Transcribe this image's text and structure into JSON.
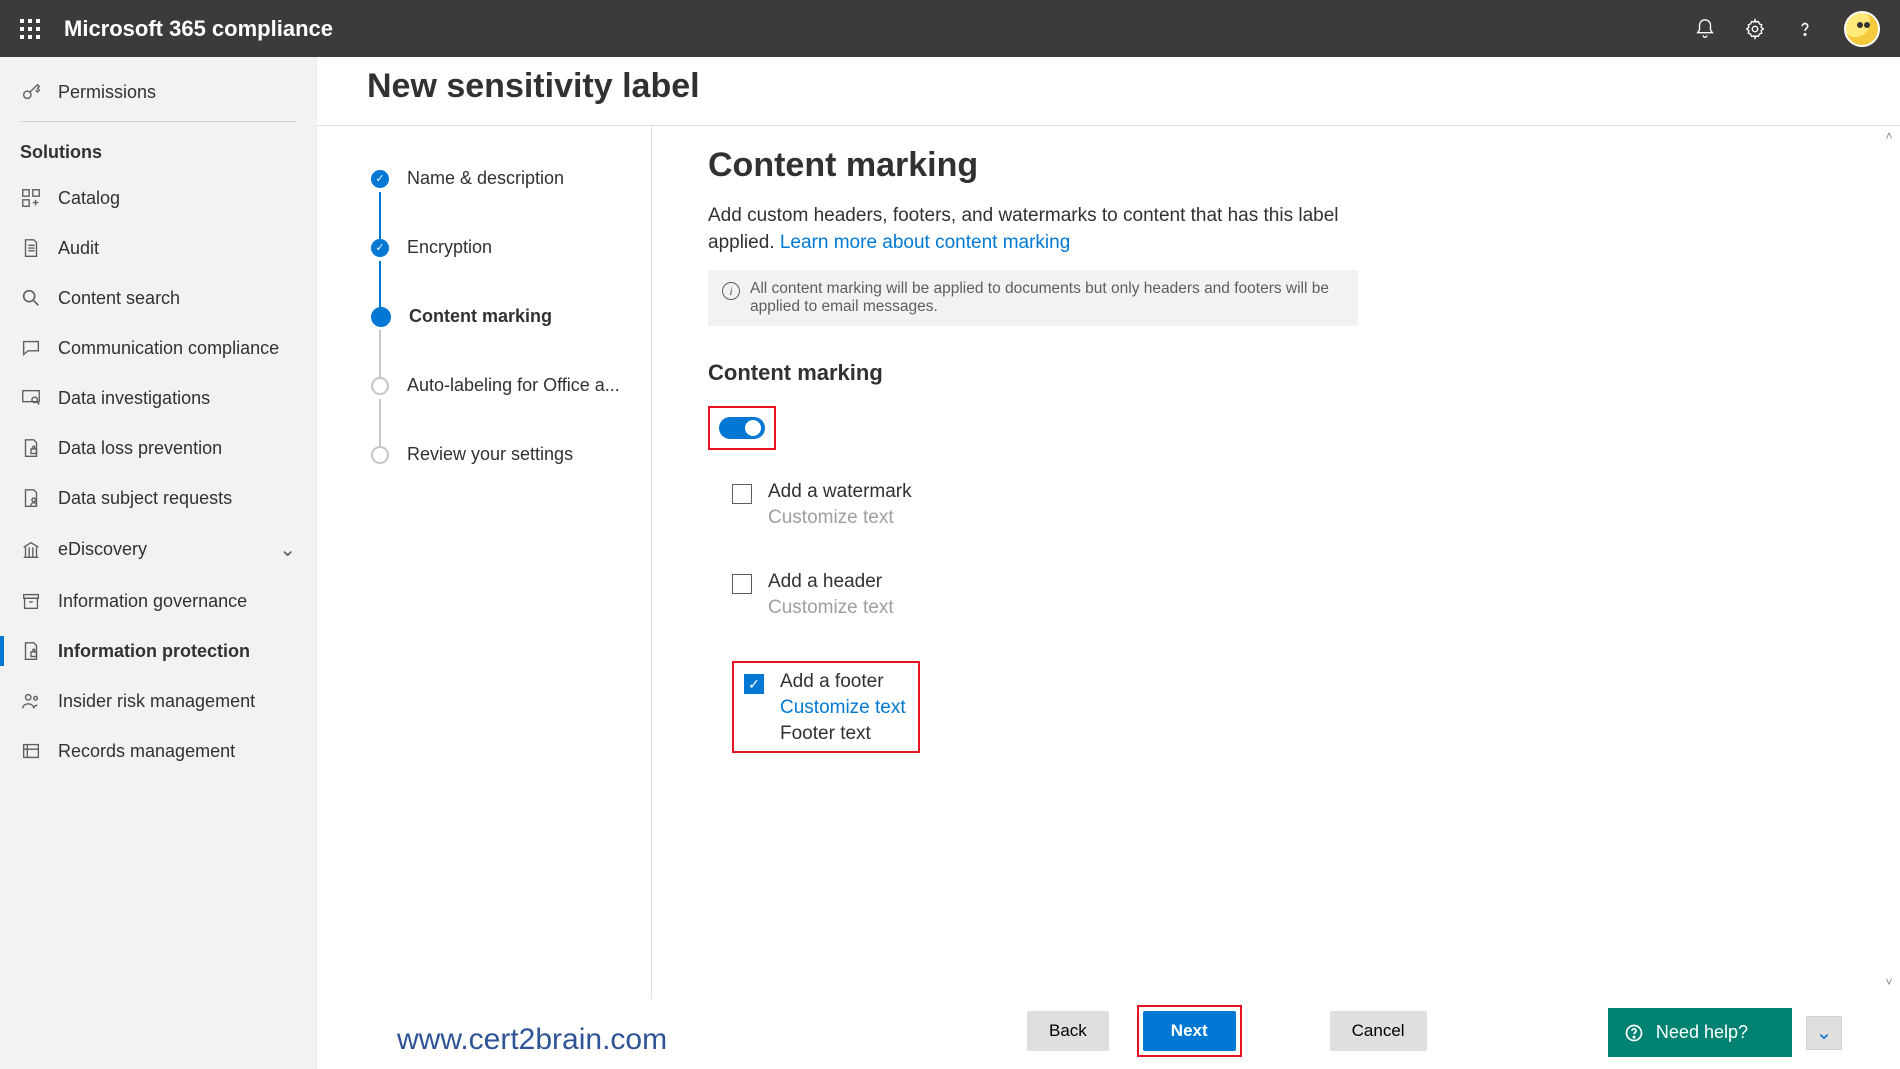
{
  "topbar": {
    "brand": "Microsoft 365 compliance"
  },
  "sidebar": {
    "permissions": "Permissions",
    "solutions_heading": "Solutions",
    "items": [
      {
        "label": "Catalog"
      },
      {
        "label": "Audit"
      },
      {
        "label": "Content search"
      },
      {
        "label": "Communication compliance"
      },
      {
        "label": "Data investigations"
      },
      {
        "label": "Data loss prevention"
      },
      {
        "label": "Data subject requests"
      },
      {
        "label": "eDiscovery"
      },
      {
        "label": "Information governance"
      },
      {
        "label": "Information protection"
      },
      {
        "label": "Insider risk management"
      },
      {
        "label": "Records management"
      }
    ]
  },
  "page_title": "New sensitivity label",
  "steps": {
    "name_desc": "Name & description",
    "encryption": "Encryption",
    "content_marking": "Content marking",
    "auto_labeling": "Auto-labeling for Office a...",
    "review": "Review your settings"
  },
  "pane": {
    "title": "Content marking",
    "desc_1": "Add custom headers, footers, and watermarks to content that has this label applied. ",
    "learn_link": "Learn more about content marking",
    "info": "All content marking will be applied to documents but only headers and footers will be applied to email messages.",
    "section_subtitle": "Content marking",
    "toggle_on": true,
    "options": {
      "watermark": {
        "label": "Add a watermark",
        "customize": "Customize text",
        "checked": false
      },
      "header": {
        "label": "Add a header",
        "customize": "Customize text",
        "checked": false
      },
      "footer": {
        "label": "Add a footer",
        "customize": "Customize text",
        "checked": true,
        "extra": "Footer text"
      }
    }
  },
  "buttons": {
    "back": "Back",
    "next": "Next",
    "cancel": "Cancel",
    "need_help": "Need help?"
  },
  "watermark_text": "www.cert2brain.com"
}
